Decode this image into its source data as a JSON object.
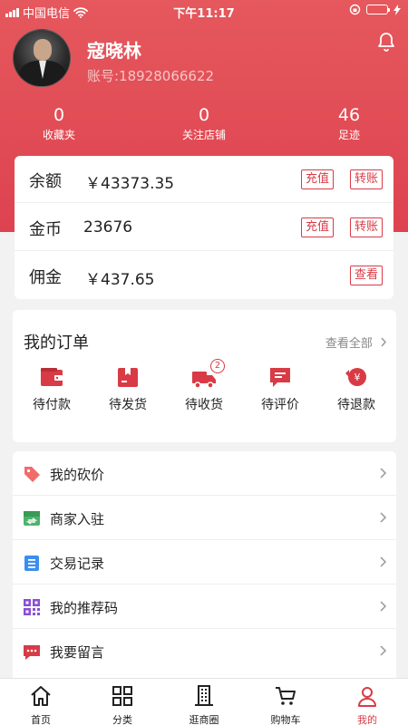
{
  "status_bar": {
    "carrier": "中国电信",
    "time": "下午11:17"
  },
  "profile": {
    "name": "寇晓林",
    "account": "账号:18928066622"
  },
  "stats": [
    {
      "value": "0",
      "label": "收藏夹"
    },
    {
      "value": "0",
      "label": "关注店铺"
    },
    {
      "value": "46",
      "label": "足迹"
    }
  ],
  "wallet": {
    "rows": [
      {
        "key": "余额",
        "value": "￥43373.35",
        "actions": [
          "充值",
          "转账"
        ]
      },
      {
        "key": "金币",
        "value": "23676",
        "actions": [
          "充值",
          "转账"
        ]
      },
      {
        "key": "佣金",
        "value": "￥437.65",
        "actions": [
          "查看"
        ]
      }
    ]
  },
  "orders": {
    "title": "我的订单",
    "view_all": "查看全部",
    "items": [
      {
        "label": "待付款",
        "icon": "wallet-icon"
      },
      {
        "label": "待发货",
        "icon": "package-icon"
      },
      {
        "label": "待收货",
        "icon": "truck-icon",
        "badge": "2"
      },
      {
        "label": "待评价",
        "icon": "comment-icon"
      },
      {
        "label": "待退款",
        "icon": "refund-icon"
      }
    ]
  },
  "menu": [
    {
      "label": "我的砍价",
      "icon": "price-tag-icon",
      "color": "#f26b6b"
    },
    {
      "label": "商家入驻",
      "icon": "store-icon",
      "color": "#4db36b"
    },
    {
      "label": "交易记录",
      "icon": "list-icon",
      "color": "#3b8ef0"
    },
    {
      "label": "我的推荐码",
      "icon": "qr-code-icon",
      "color": "#8a4fd6"
    },
    {
      "label": "我要留言",
      "icon": "message-icon",
      "color": "#d83b45"
    }
  ],
  "tabs": [
    {
      "label": "首页",
      "icon": "home-icon"
    },
    {
      "label": "分类",
      "icon": "grid-icon"
    },
    {
      "label": "逛商圈",
      "icon": "building-icon"
    },
    {
      "label": "购物车",
      "icon": "cart-icon"
    },
    {
      "label": "我的",
      "icon": "user-icon",
      "active": true
    }
  ],
  "colors": {
    "primary": "#d83b45",
    "header": "#e14b55"
  }
}
